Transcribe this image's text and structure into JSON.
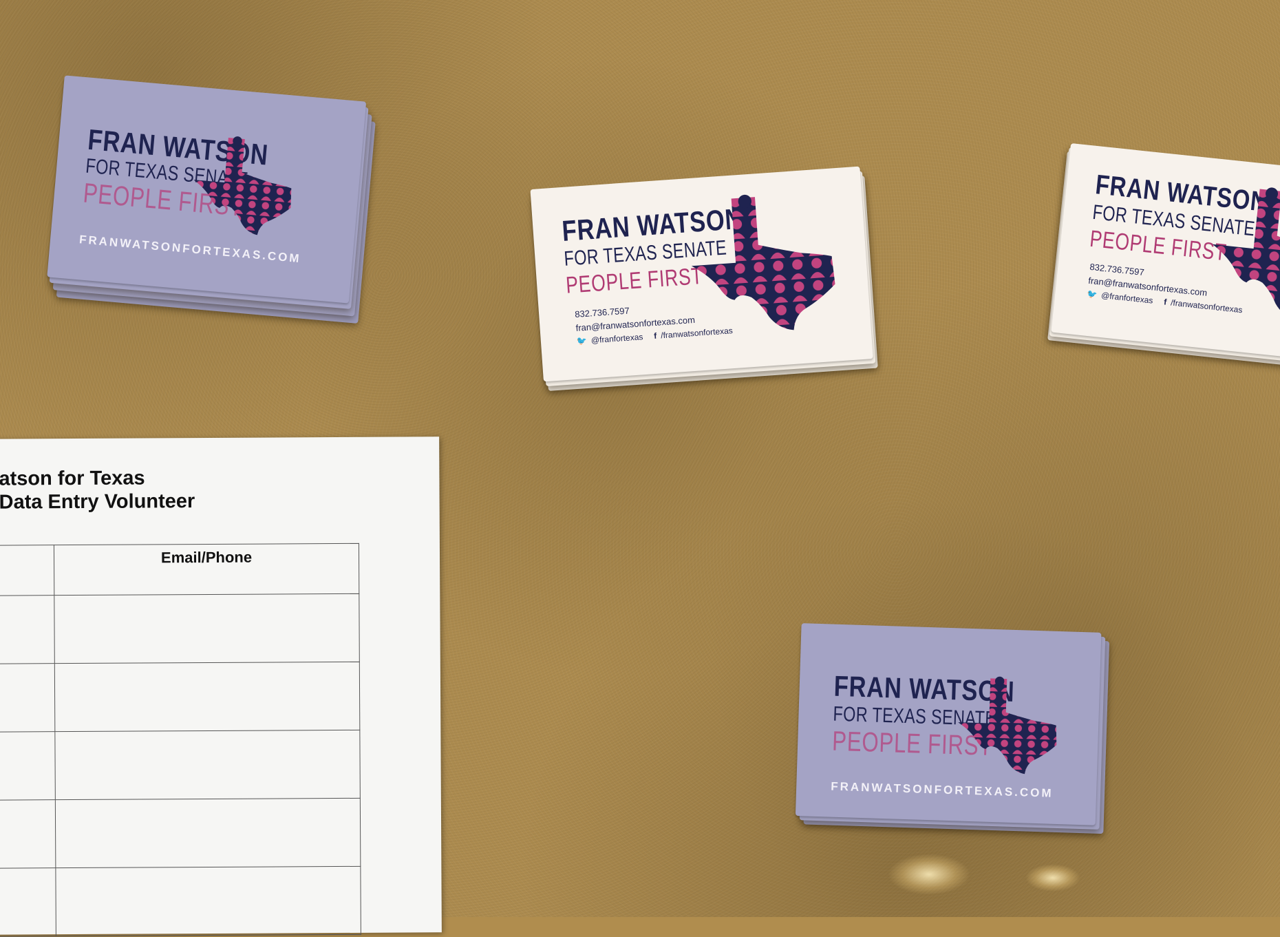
{
  "scene": {
    "surface_color": "#ac8b4f",
    "card_navy": "#1f2350",
    "card_magenta": "#b03b73",
    "card_lavender": "#a4a3c5"
  },
  "cards": {
    "name": "FRAN WATSON",
    "subtitle": "FOR TEXAS SENATE",
    "slogan": "PEOPLE FIRST",
    "url": "FRANWATSONFORTEXAS.COM",
    "phone": "832.736.7597",
    "email": "fran@franwatsonfortexas.com",
    "twitter": "@franfortexas",
    "facebook": "/franwatsonfortexas",
    "logo_icon": "texas-map-people-icon"
  },
  "signup_sheet": {
    "title_line1": "atson for Texas",
    "title_line2": "Data Entry Volunteer",
    "column_header": "Email/Phone",
    "row_count": 5
  }
}
